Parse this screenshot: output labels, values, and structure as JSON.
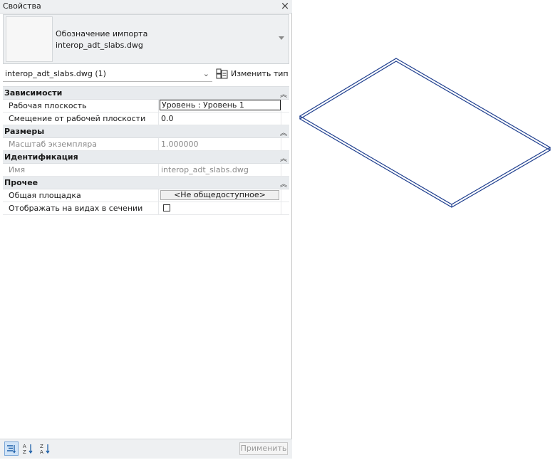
{
  "window": {
    "title": "Свойства"
  },
  "type_selector": {
    "family": "Обозначение импорта",
    "type_name": "interop_adt_slabs.dwg"
  },
  "instance_selector": {
    "value": "interop_adt_slabs.dwg (1)",
    "edit_type_label": "Изменить тип"
  },
  "categories": {
    "constraints": {
      "label": "Зависимости",
      "rows": [
        {
          "name": "Рабочая плоскость",
          "value": "Уровень : Уровень 1"
        },
        {
          "name": "Смещение от рабочей плоскости",
          "value": "0.0"
        }
      ]
    },
    "dimensions": {
      "label": "Размеры",
      "rows": [
        {
          "name": "Масштаб экземпляра",
          "value": "1.000000"
        }
      ]
    },
    "identity": {
      "label": "Идентификация",
      "rows": [
        {
          "name": "Имя",
          "value": "interop_adt_slabs.dwg"
        }
      ]
    },
    "other": {
      "label": "Прочее",
      "rows": [
        {
          "name": "Общая площадка",
          "value": "<Не общедоступное>"
        },
        {
          "name": "Отображать на видах в сечении",
          "checked": false
        }
      ]
    }
  },
  "footer": {
    "apply_label": "Применить"
  },
  "icons": [
    "close-icon",
    "dropdown-arrow-icon",
    "chevron-down-icon",
    "edit-type-icon",
    "collapse-icon",
    "categorized-view-icon",
    "sort-ascending-icon",
    "sort-descending-icon"
  ],
  "colors": {
    "slab_outline": "#1f3f8f",
    "header_bg": "#e8ebee",
    "active_button": "#cfe3f7"
  }
}
